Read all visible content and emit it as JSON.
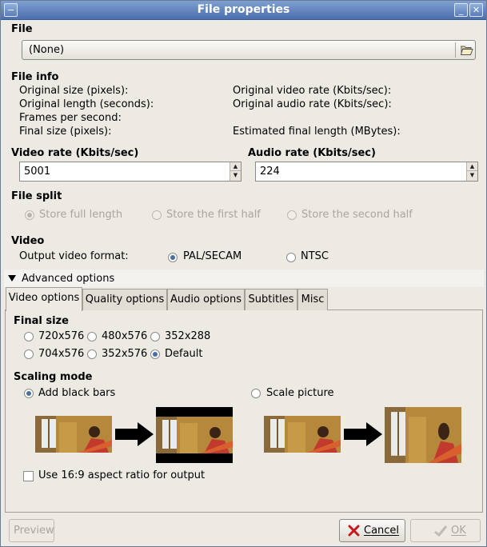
{
  "window": {
    "title": "File properties",
    "menu_glyph": "−",
    "minimize_glyph": "_",
    "close_glyph": "✕"
  },
  "file": {
    "heading": "File",
    "selected": "(None)"
  },
  "file_info": {
    "heading": "File info",
    "original_size": "Original size (pixels):",
    "original_length": "Original length (seconds):",
    "frames_per_second": "Frames per second:",
    "final_size": "Final size (pixels):",
    "original_video_rate": "Original video rate (Kbits/sec):",
    "original_audio_rate": "Original audio rate (Kbits/sec):",
    "estimated_final_length": "Estimated final length (MBytes):"
  },
  "video_rate": {
    "label": "Video rate (Kbits/sec)",
    "value": "5001"
  },
  "audio_rate": {
    "label": "Audio rate (Kbits/sec)",
    "value": "224"
  },
  "file_split": {
    "heading": "File split",
    "options": [
      "Store full length",
      "Store the first half",
      "Store the second half"
    ],
    "selected": "Store full length",
    "enabled": false
  },
  "video": {
    "heading": "Video",
    "output_format_label": "Output video format:",
    "options": [
      "PAL/SECAM",
      "NTSC"
    ],
    "selected": "PAL/SECAM"
  },
  "advanced": {
    "label": "Advanced options",
    "expanded": true
  },
  "tabs": [
    "Video options",
    "Quality options",
    "Audio options",
    "Subtitles",
    "Misc"
  ],
  "active_tab": "Video options",
  "final_size": {
    "heading": "Final size",
    "options": [
      "720x576",
      "480x576",
      "352x288",
      "704x576",
      "352x576",
      "Default"
    ],
    "selected": "Default"
  },
  "scaling_mode": {
    "heading": "Scaling mode",
    "options": [
      "Add black bars",
      "Scale picture"
    ],
    "selected": "Add black bars"
  },
  "aspect_checkbox": {
    "label": "Use 16:9 aspect ratio for output",
    "checked": false
  },
  "buttons": {
    "preview": "Preview",
    "cancel": "Cancel",
    "ok": "OK"
  },
  "colors": {
    "titlebar": "#4c6fae",
    "window_bg": "#ede9e3",
    "radio_selected": "#4a6fa5",
    "disabled_text": "#aaa59d"
  }
}
